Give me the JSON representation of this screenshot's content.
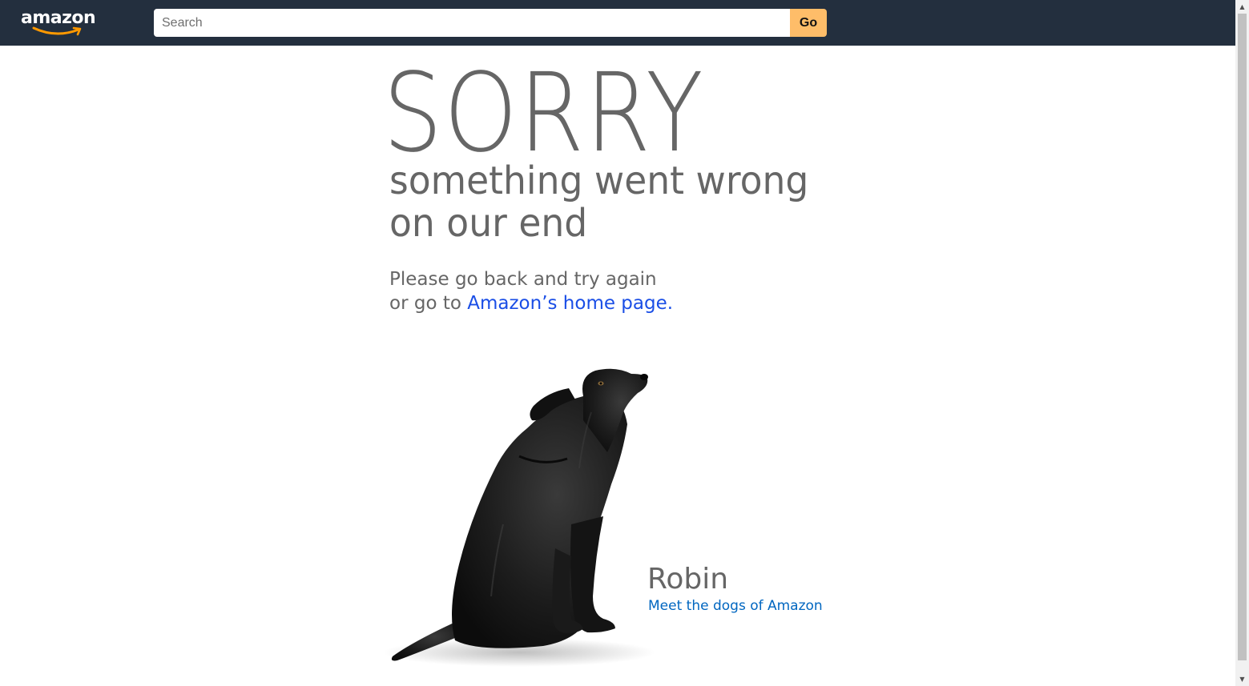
{
  "header": {
    "logo_text": "amazon",
    "search": {
      "placeholder": "Search",
      "value": ""
    },
    "go_label": "Go"
  },
  "error": {
    "headline": "SORRY",
    "subtitle_line1": "something went wrong",
    "subtitle_line2": "on our end",
    "message_line1": "Please go back and try again",
    "message_prefix": "or go to ",
    "home_link_text": "Amazon’s home page."
  },
  "dog": {
    "name": "Robin",
    "link_text": "Meet the dogs of Amazon"
  },
  "colors": {
    "nav_background": "#232f3e",
    "go_button": "#febd69",
    "text_gray": "#666666",
    "link_blue": "#1a4ee6",
    "dogs_link_blue": "#0066c0",
    "logo_smile": "#ff9900"
  },
  "icons": {
    "logo": "amazon-logo",
    "scroll_up": "scroll-up-arrow-icon",
    "scroll_down": "scroll-down-arrow-icon"
  }
}
